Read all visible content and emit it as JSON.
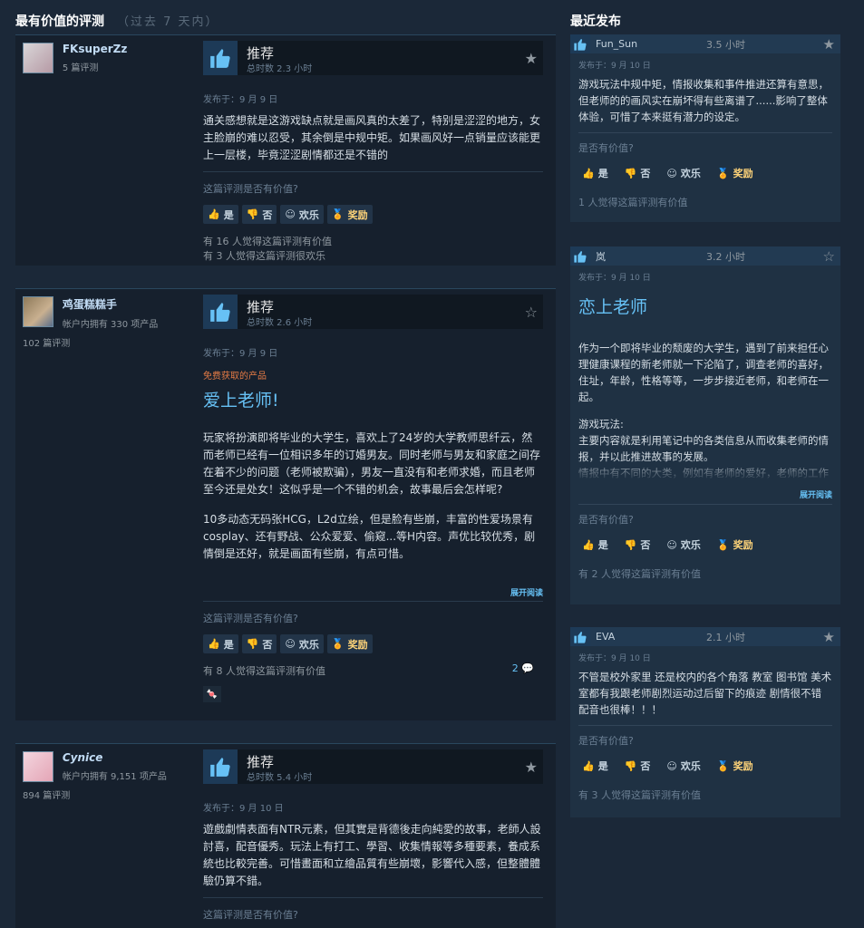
{
  "left_section": {
    "title": "最有价值的评测",
    "subtitle": "（过去 7 天内）"
  },
  "right_section": {
    "title": "最近发布"
  },
  "helpful_question": "这篇评测是否有价值?",
  "buttons": {
    "yes": "是",
    "no": "否",
    "funny": "欢乐",
    "award": "奖励"
  },
  "expand_label": "展开阅读",
  "reviews": [
    {
      "author": "FKsuperZz",
      "meta": "5 篇评测",
      "reviews_count": "",
      "recommend": "推荐",
      "hours": "总时数 2.3 小时",
      "posted": "发布于：9 月 9 日",
      "free": "",
      "heading": "",
      "text": "通关感想就是这游戏缺点就是画风真的太差了，特别是涩涩的地方，女主脸崩的难以忍受，其余倒是中规中矩。如果画风好一点销量应该能更上一层楼，毕竟涩涩剧情都还是不错的",
      "stat1": "有 16 人觉得这篇评测有价值",
      "stat2": "有 3 人觉得这篇评测很欢乐",
      "comments": ""
    },
    {
      "author": "鸡蛋糕糕手",
      "meta": "帐户内拥有 330 项产品",
      "reviews_count": "102 篇评测",
      "recommend": "推荐",
      "hours": "总时数 2.6 小时",
      "posted": "发布于：9 月 9 日",
      "free": "免费获取的产品",
      "heading": "爱上老师!",
      "text": "玩家将扮演即将毕业的大学生，喜欢上了24岁的大学教师思纤云，然而老师已经有一位相识多年的订婚男友。同时老师与男友和家庭之间存在着不少的问题（老师被欺骗），男友一直没有和老师求婚，而且老师至今还是处女！这似乎是一个不错的机会，故事最后会怎样呢?",
      "text2": "10多动态无码张HCG，L2d立绘，但是脸有些崩，丰富的性爱场景有cosplay、还有野战、公众爱爱、偷窥...等H内容。声优比较优秀，剧情倒是还好，就是画面有些崩，有点可惜。",
      "stat1": "有 8 人觉得这篇评测有价值",
      "stat2": "",
      "comments": "2"
    },
    {
      "author": "Cynice",
      "meta": "帐户内拥有 9,151 项产品",
      "reviews_count": "894 篇评测",
      "recommend": "推荐",
      "hours": "总时数 5.4 小时",
      "posted": "发布于：9 月 10 日",
      "free": "",
      "heading": "",
      "text": "遊戲劇情表面有NTR元素，但其實是背德後走向純愛的故事，老師人設討喜，配音優秀。玩法上有打工、學習、收集情報等多種要素，養成系統也比較完善。可惜畫面和立繪品質有些崩壞，影響代入感，但整體體驗仍算不錯。",
      "stat1": "",
      "stat2": "",
      "comments": ""
    }
  ],
  "recent": [
    {
      "author": "Fun_Sun",
      "hours": "3.5 小时",
      "posted": "发布于：9 月 10 日",
      "heading": "",
      "text": "游戏玩法中规中矩，情报收集和事件推进还算有意思，但老师的的画风实在崩坏得有些离谱了......影响了整体体验，可惜了本来挺有潜力的设定。",
      "question": "是否有价值?",
      "stat": "1 人觉得这篇评测有价值"
    },
    {
      "author": "岚",
      "hours": "3.2 小时",
      "posted": "发布于：9 月 10 日",
      "heading": "恋上老师",
      "text": "作为一个即将毕业的颓废的大学生，遇到了前来担任心理健康课程的新老师就一下沦陷了，调查老师的喜好，住址，年龄，性格等等，一步步接近老师，和老师在一起。",
      "text2": "游戏玩法:\n主要内容就是利用笔记中的各类信息从而收集老师的情报，并以此推进故事的发展。\n情报中有不同的大类，例如有老师的爱好，老师的工作等等，完成一个大类的所有情报收集，可以解",
      "question": "是否有价值?",
      "stat": "有 2 人觉得这篇评测有价值"
    },
    {
      "author": "EVA",
      "hours": "2.1 小时",
      "posted": "发布于：9 月 10 日",
      "heading": "",
      "text": "不管是校外家里 还是校内的各个角落 教室 图书馆 美术室都有我跟老师剧烈运动过后留下的痕迹 剧情很不错 配音也很棒！！！",
      "question": "是否有价值?",
      "stat": "有 3 人觉得这篇评测有价值"
    }
  ],
  "colors": {
    "accent": "#66c0f4",
    "award": "#ffd479",
    "free": "#e57b45",
    "background": "#1b2838"
  }
}
